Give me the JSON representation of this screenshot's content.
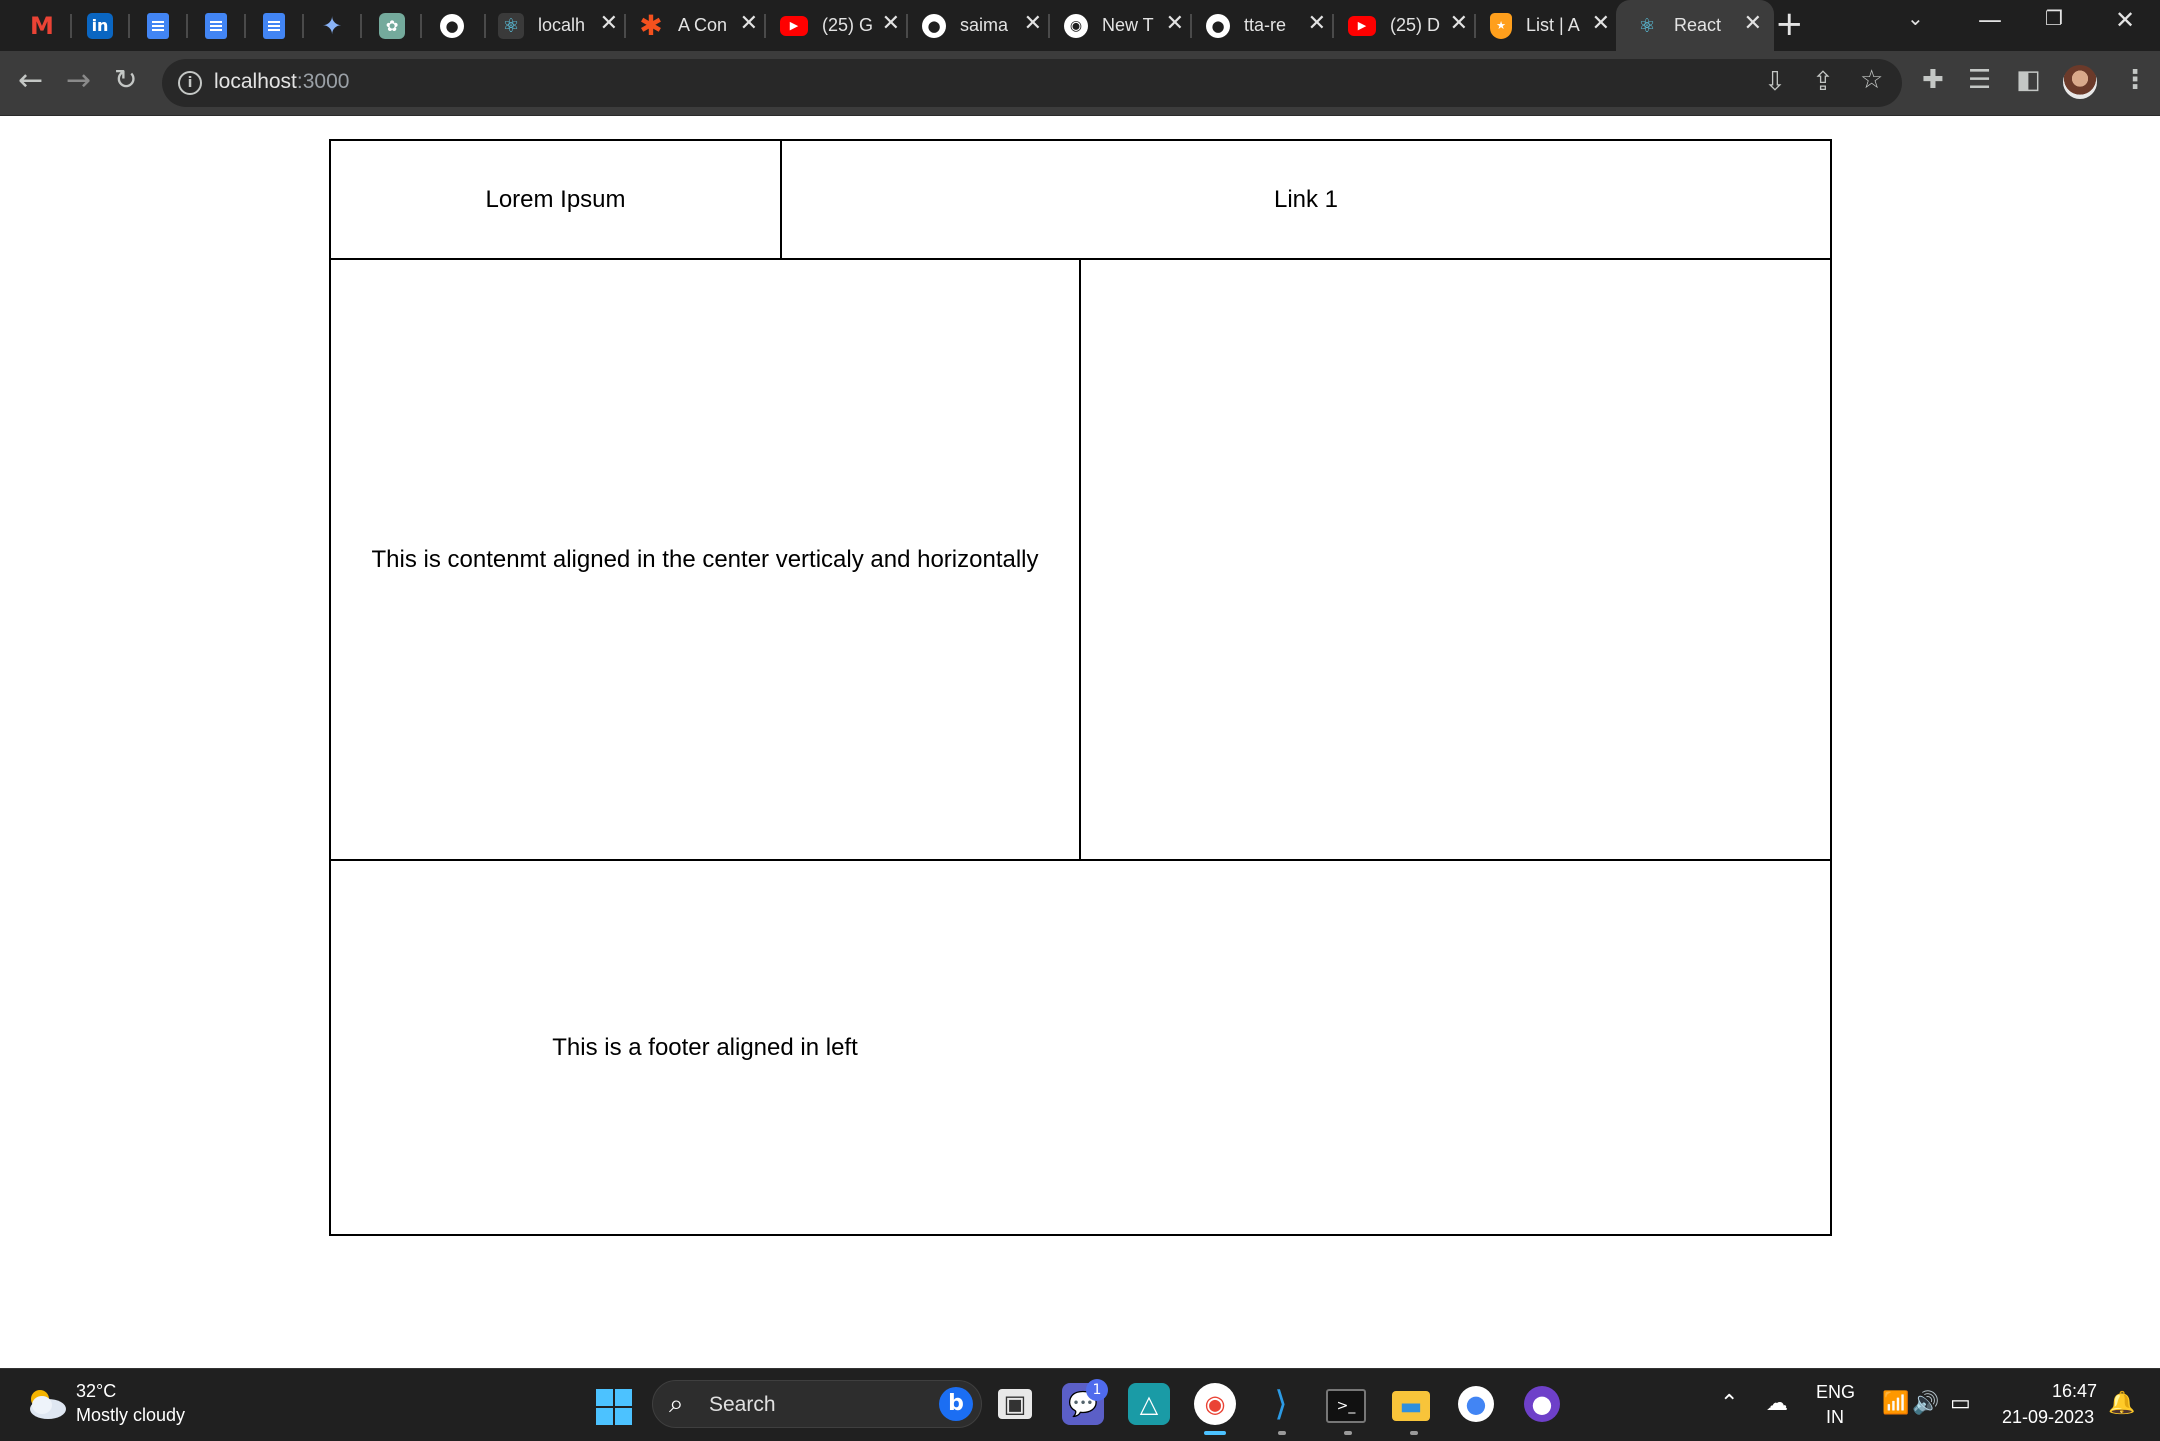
{
  "browser": {
    "tabs": [
      {
        "title": "localh",
        "favicon": "react-icon"
      },
      {
        "title": "A Con",
        "favicon": "asterisk-icon"
      },
      {
        "title": "(25) G",
        "favicon": "youtube-icon"
      },
      {
        "title": "saima",
        "favicon": "github-icon"
      },
      {
        "title": "New T",
        "favicon": "chrome-icon"
      },
      {
        "title": "tta-re",
        "favicon": "github-icon"
      },
      {
        "title": "(25) D",
        "favicon": "youtube-icon"
      },
      {
        "title": "List | A",
        "favicon": "shield-icon"
      },
      {
        "title": "React",
        "favicon": "react-icon",
        "active": true
      }
    ],
    "pinned_tabs": [
      "gmail-icon",
      "linkedin-icon",
      "google-docs-icon",
      "google-docs-icon",
      "google-docs-icon",
      "gemini-icon",
      "chatgpt-icon",
      "github-icon"
    ],
    "url_host": "localhost",
    "url_port": ":3000"
  },
  "page": {
    "header": {
      "title": "Lorem Ipsum",
      "link": "Link 1"
    },
    "main": {
      "content": "This is contenmt aligned in the center verticaly and horizontally"
    },
    "footer": {
      "text": "This is a footer aligned in left"
    }
  },
  "taskbar": {
    "weather_temp": "32°C",
    "weather_desc": "Mostly cloudy",
    "search_label": "Search",
    "language_top": "ENG",
    "language_bottom": "IN",
    "time": "16:47",
    "date": "21-09-2023",
    "notification_badge": "1"
  },
  "colors": {
    "tabstrip": "#1f1f1f",
    "toolbar": "#3c3c3c",
    "taskbar": "#202020",
    "accent": "#4cc2ff"
  }
}
